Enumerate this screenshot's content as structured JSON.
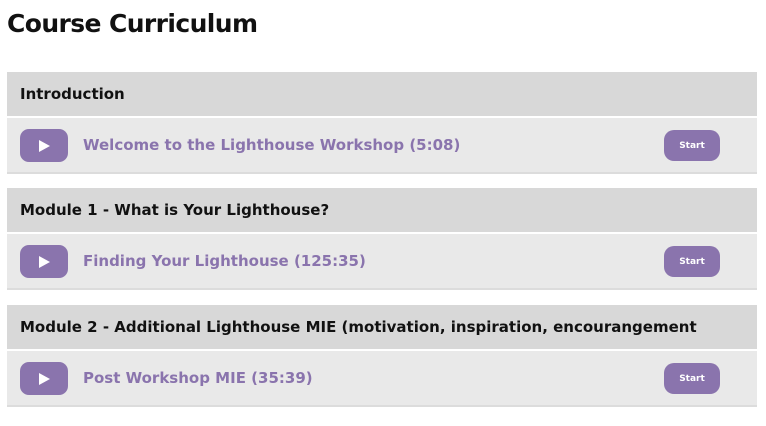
{
  "page_title": "Course Curriculum",
  "colors": {
    "accent": "#8a74ad",
    "section_header_bg": "#d8d8d8",
    "lesson_bg": "#e9e9e9"
  },
  "icons": {
    "lesson_play": "play-icon"
  },
  "sections": [
    {
      "title": "Introduction",
      "lessons": [
        {
          "title": "Welcome to the Lighthouse Workshop (5:08)",
          "start_label": "Start"
        }
      ]
    },
    {
      "title": "Module 1 - What is Your Lighthouse?",
      "lessons": [
        {
          "title": "Finding Your Lighthouse (125:35)",
          "start_label": "Start"
        }
      ]
    },
    {
      "title": "Module 2 - Additional Lighthouse MIE (motivation, inspiration, encourangement",
      "lessons": [
        {
          "title": "Post Workshop MIE (35:39)",
          "start_label": "Start"
        }
      ]
    }
  ]
}
